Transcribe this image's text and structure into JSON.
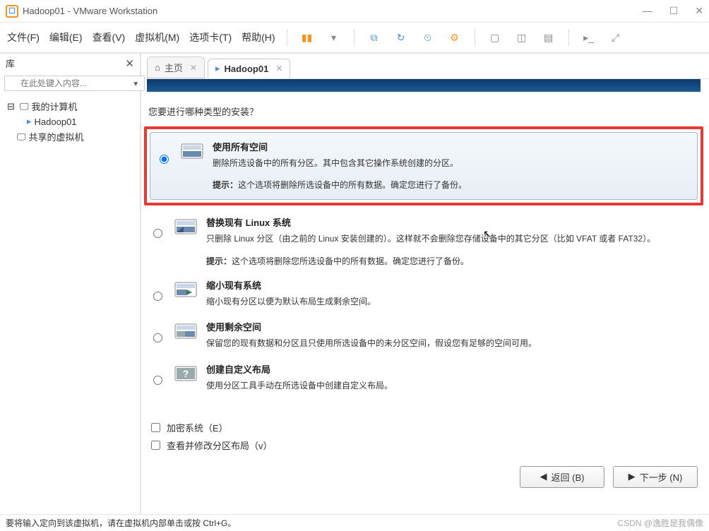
{
  "window": {
    "title": "Hadoop01 - VMware Workstation"
  },
  "menu": {
    "file": "文件(F)",
    "edit": "编辑(E)",
    "view": "查看(V)",
    "vm": "虚拟机(M)",
    "tabs": "选项卡(T)",
    "help": "帮助(H)"
  },
  "sidebar": {
    "title": "库",
    "search_placeholder": "在此处键入内容...",
    "root": "我的计算机",
    "child": "Hadoop01",
    "shared": "共享的虚拟机"
  },
  "tabs": {
    "home": "主页",
    "vm": "Hadoop01"
  },
  "installer": {
    "question": "您要进行哪种类型的安装？",
    "options": [
      {
        "title": "使用所有空间",
        "desc": "删除所选设备中的所有分区。其中包含其它操作系统创建的分区。",
        "hint": "提示：这个选项将删除所选设备中的所有数据。确定您进行了备份。",
        "selected": true
      },
      {
        "title": "替换现有 Linux 系统",
        "desc": "只删除 Linux 分区（由之前的 Linux 安装创建的）。这样就不会删除您存储设备中的其它分区（比如 VFAT 或者 FAT32）。",
        "hint": "提示：这个选项将删除您所选设备中的所有数据。确定您进行了备份。",
        "selected": false
      },
      {
        "title": "缩小现有系统",
        "desc": "缩小现有分区以便为默认布局生成剩余空间。",
        "selected": false
      },
      {
        "title": "使用剩余空间",
        "desc": "保留您的现有数据和分区且只使用所选设备中的未分区空间，假设您有足够的空间可用。",
        "selected": false
      },
      {
        "title": "创建自定义布局",
        "desc": "使用分区工具手动在所选设备中创建自定义布局。",
        "selected": false,
        "unknown": true
      }
    ],
    "check_encrypt": "加密系统（E）",
    "check_review": "查看并修改分区布局（v）",
    "back": "返回 (B)",
    "next": "下一步 (N)"
  },
  "statusbar": {
    "text": "要将输入定向到该虚拟机，请在虚拟机内部单击或按 Ctrl+G。",
    "watermark": "CSDN @逸胜是我偶像"
  }
}
